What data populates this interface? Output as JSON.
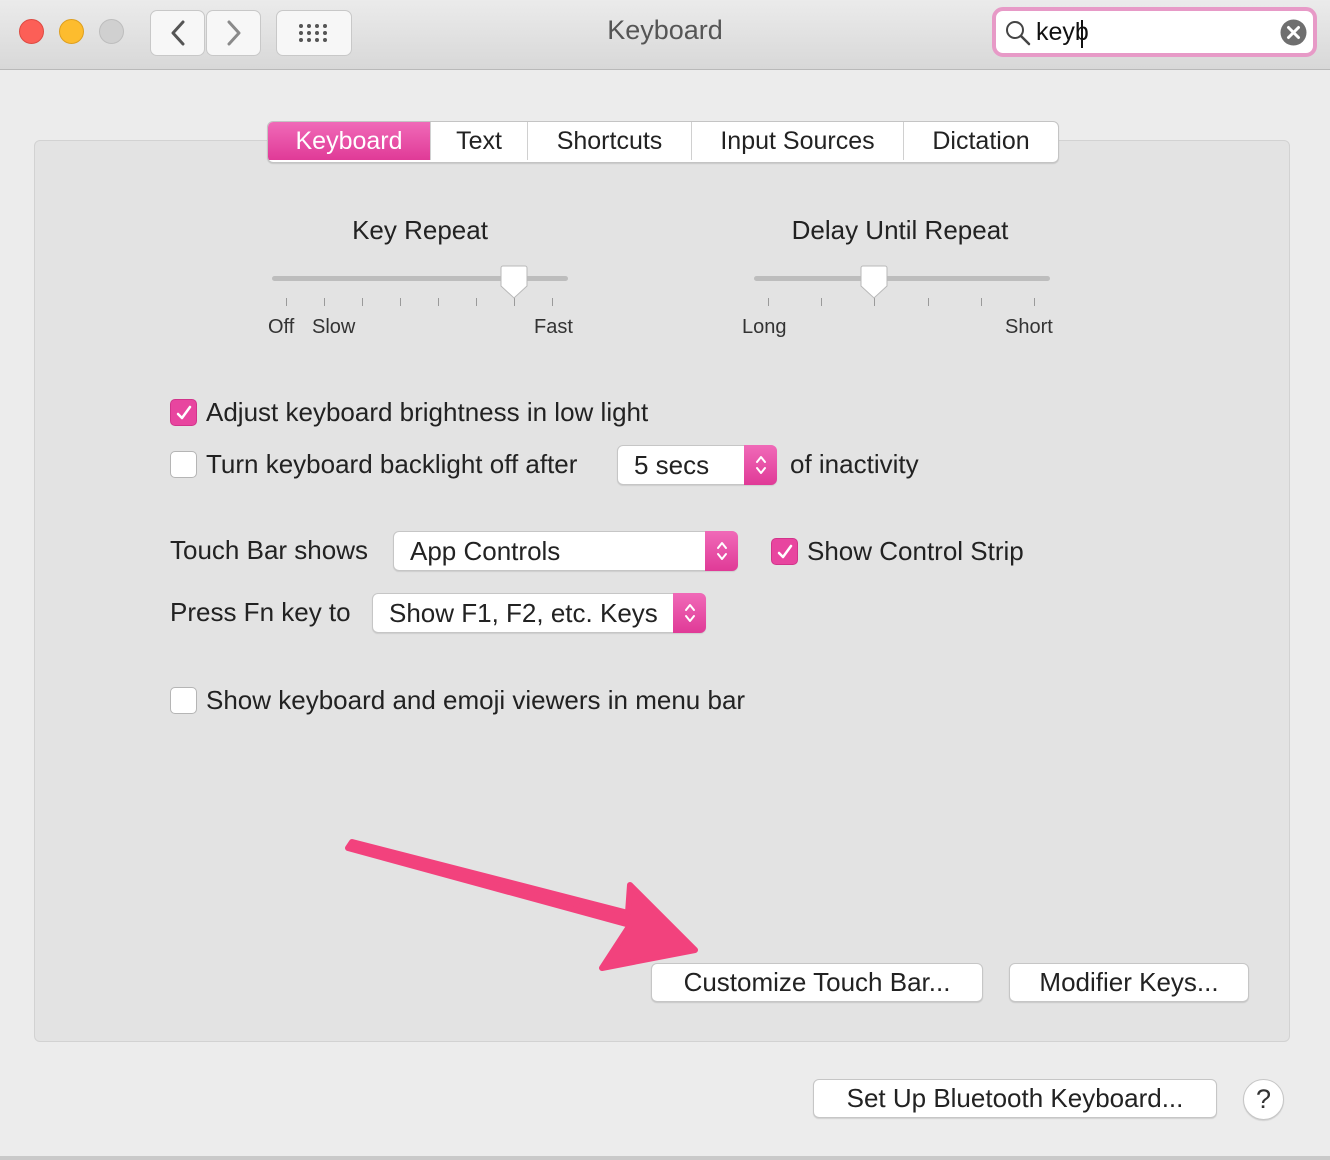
{
  "window": {
    "title": "Keyboard"
  },
  "search": {
    "value": "keyb"
  },
  "tabs": [
    {
      "label": "Keyboard",
      "active": true
    },
    {
      "label": "Text"
    },
    {
      "label": "Shortcuts"
    },
    {
      "label": "Input Sources"
    },
    {
      "label": "Dictation"
    }
  ],
  "key_repeat": {
    "title": "Key Repeat",
    "label_off": "Off",
    "label_slow": "Slow",
    "label_fast": "Fast",
    "position": 0.82
  },
  "delay_until_repeat": {
    "title": "Delay Until Repeat",
    "label_long": "Long",
    "label_short": "Short",
    "position": 0.4
  },
  "options": {
    "adjust_brightness": {
      "label": "Adjust keyboard brightness in low light",
      "checked": true
    },
    "backlight_off": {
      "label": "Turn keyboard backlight off after",
      "checked": false,
      "select_value": "5 secs",
      "suffix": "of inactivity"
    },
    "touch_bar": {
      "label": "Touch Bar shows",
      "select_value": "App Controls"
    },
    "control_strip": {
      "label": "Show Control Strip",
      "checked": true
    },
    "fn_key": {
      "label": "Press Fn key to",
      "select_value": "Show F1, F2, etc. Keys"
    },
    "viewers": {
      "label": "Show keyboard and emoji viewers in menu bar",
      "checked": false
    }
  },
  "buttons": {
    "customize_touch_bar": "Customize Touch Bar...",
    "modifier_keys": "Modifier Keys...",
    "bluetooth": "Set Up Bluetooth Keyboard...",
    "help": "?"
  },
  "colors": {
    "accent": "#e8459f",
    "arrow": "#f2427d"
  }
}
